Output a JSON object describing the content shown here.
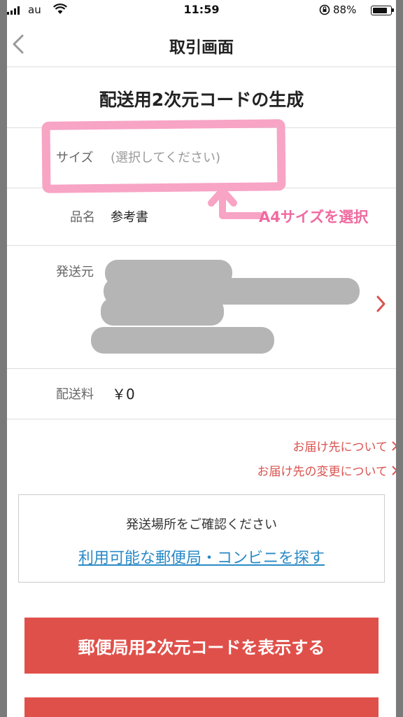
{
  "status_bar": {
    "carrier": "au",
    "time": "11:59",
    "battery_percent": "88%"
  },
  "nav": {
    "title": "取引画面"
  },
  "page": {
    "heading": "配送用2次元コードの生成"
  },
  "form": {
    "size_label": "サイズ",
    "size_placeholder": "(選択してください)",
    "item_label": "品名",
    "item_value": "参考書",
    "sender_label": "発送元",
    "fee_label": "配送料",
    "fee_value": "￥0"
  },
  "links": {
    "about_destination": "お届け先について",
    "change_destination": "お届け先の変更について"
  },
  "confirm": {
    "message": "発送場所をご確認ください",
    "find_link": "利用可能な郵便局・コンビニを探す"
  },
  "actions": {
    "show_code_button": "郵便局用2次元コードを表示する"
  },
  "annotation": {
    "text": "A4サイズを選択",
    "color": "#f06aa0"
  },
  "colors": {
    "accent_red": "#e0504a",
    "link_blue": "#2a8ac6"
  }
}
